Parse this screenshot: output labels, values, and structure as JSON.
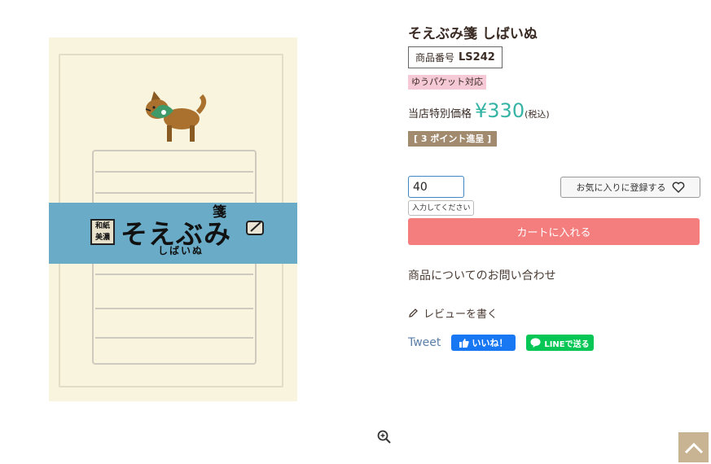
{
  "product": {
    "title": "そえぶみ箋 しばいぬ",
    "code_label": "商品番号",
    "code_value": "LS242",
    "shipping_tag": "ゆうパケット対応",
    "price_label": "当店特別価格",
    "price_value": "¥330",
    "price_tax": "(税込)",
    "points_label": "[ 3 ポイント進呈 ]"
  },
  "image": {
    "seal_text": "和紙\n美濃",
    "band_title": "そえぶみ",
    "band_title_kanji": "箋",
    "band_subtitle": "しばいぬ"
  },
  "purchase": {
    "quantity_value": "40",
    "quantity_tip": "入力してください",
    "favorite_label": "お気に入りに登録する",
    "cart_label": "カートに入れる"
  },
  "links": {
    "inquiry": "商品についてのお問い合わせ",
    "review": "レビューを書く"
  },
  "social": {
    "tweet": "Tweet",
    "facebook": "いいね！",
    "line": "LINEで送る"
  },
  "icons": {
    "zoom": "zoom-in-icon",
    "heart": "heart-icon",
    "pencil": "pencil-icon",
    "back_to_top": "chevron-up-icon"
  },
  "colors": {
    "price": "#35b4a6",
    "cart_button": "#f47e7e",
    "shipping_tag": "#f6c9d7",
    "points_badge": "#a18a6e",
    "facebook": "#1877f2",
    "line": "#06c755",
    "back_to_top": "#c8b393",
    "band": "#6aacc8"
  }
}
